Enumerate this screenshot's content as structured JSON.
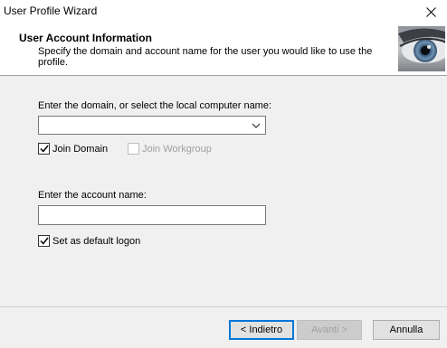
{
  "window": {
    "title": "User Profile Wizard"
  },
  "header": {
    "title": "User Account  Information",
    "subtitle": "Specify the domain and account name for the user you would like to use the profile."
  },
  "domain": {
    "label": "Enter the domain, or select the local computer name:",
    "value": ""
  },
  "join_domain": {
    "label": "Join Domain",
    "checked": true
  },
  "join_workgroup": {
    "label": "Join Workgroup",
    "checked": false,
    "enabled": false
  },
  "account": {
    "label": "Enter the account name:",
    "value": ""
  },
  "default_logon": {
    "label": "Set as default logon",
    "checked": true
  },
  "buttons": {
    "back": "< Indietro",
    "next": "Avanti >",
    "cancel": "Annulla"
  }
}
